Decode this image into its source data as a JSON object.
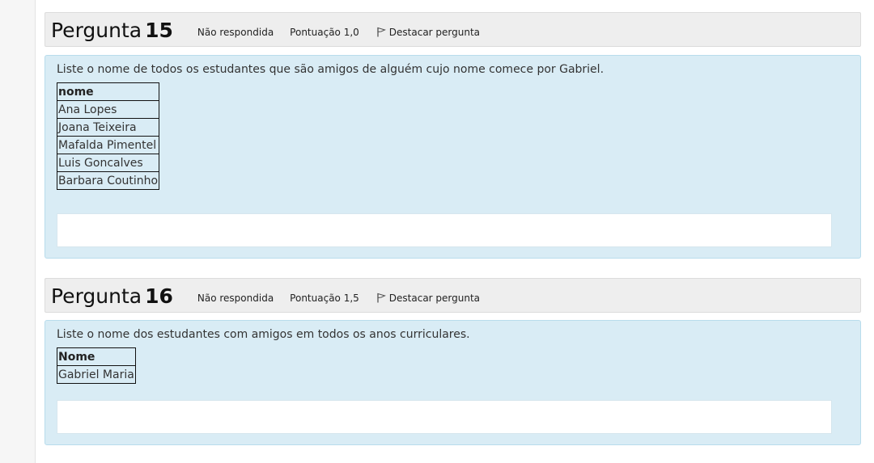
{
  "questions": [
    {
      "title_prefix": "Pergunta",
      "number": "15",
      "status": "Não respondida",
      "score": "Pontuação 1,0",
      "flag_label": "Destacar pergunta",
      "text": "Liste o nome de todos os estudantes que são amigos de alguém cujo nome comece por Gabriel.",
      "table": {
        "header": "nome",
        "rows": [
          "Ana Lopes",
          "Joana Teixeira",
          "Mafalda Pimentel",
          "Luis Goncalves",
          "Barbara Coutinho"
        ]
      },
      "answer": ""
    },
    {
      "title_prefix": "Pergunta",
      "number": "16",
      "status": "Não respondida",
      "score": "Pontuação 1,5",
      "flag_label": "Destacar pergunta",
      "text": "Liste o nome dos estudantes com amigos em todos os anos curriculares.",
      "table": {
        "header": "Nome",
        "rows": [
          "Gabriel Maria"
        ]
      },
      "answer": ""
    }
  ],
  "icons": {
    "flag": "flag-icon"
  }
}
